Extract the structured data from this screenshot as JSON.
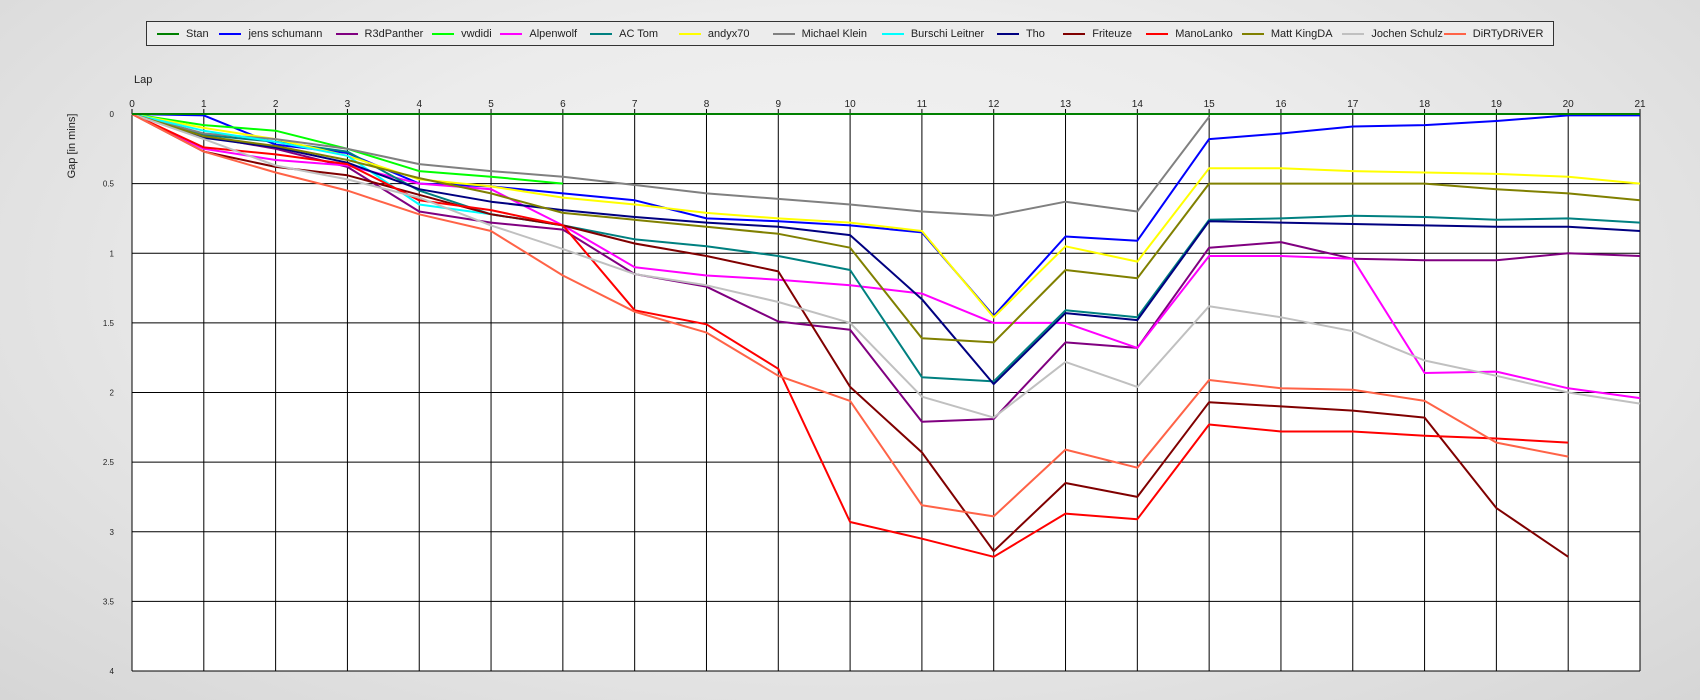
{
  "chart_data": {
    "type": "line",
    "xlabel": "Lap",
    "ylabel": "Gap [in mins]",
    "xlim": [
      0,
      21
    ],
    "ylim": [
      0,
      4
    ],
    "y_inverted": true,
    "x_ticks": [
      0,
      1,
      2,
      3,
      4,
      5,
      6,
      7,
      8,
      9,
      10,
      11,
      12,
      13,
      14,
      15,
      16,
      17,
      18,
      19,
      20,
      21
    ],
    "y_ticks": [
      "0",
      "0.5",
      "1",
      "1.5",
      "2",
      "2.5",
      "3",
      "3.5",
      "4"
    ],
    "grid": true,
    "legend_position": "top",
    "x": [
      0,
      1,
      2,
      3,
      4,
      5,
      6,
      7,
      8,
      9,
      10,
      11,
      12,
      13,
      14,
      15,
      16,
      17,
      18,
      19,
      20,
      21
    ],
    "series": [
      {
        "name": "Stan",
        "color": "#008000",
        "values": [
          0,
          0,
          0,
          0,
          0,
          0,
          0,
          0,
          0,
          0,
          0,
          0,
          0,
          0,
          0,
          0,
          0,
          0,
          0,
          0,
          0,
          0
        ]
      },
      {
        "name": "jens  schumann",
        "color": "#0000ff",
        "values": [
          0,
          0.01,
          0.22,
          0.28,
          0.5,
          0.52,
          0.57,
          0.62,
          0.75,
          0.77,
          0.8,
          0.85,
          1.45,
          0.88,
          0.91,
          0.18,
          0.14,
          0.09,
          0.08,
          0.05,
          0.01,
          0.01
        ]
      },
      {
        "name": "R3dPanther",
        "color": "#800080",
        "values": [
          0,
          0.16,
          0.25,
          0.38,
          0.7,
          0.78,
          0.83,
          1.15,
          1.24,
          1.49,
          1.55,
          2.21,
          2.19,
          1.64,
          1.68,
          0.96,
          0.92,
          1.04,
          1.05,
          1.05,
          1.0,
          1.02
        ]
      },
      {
        "name": "vwdidi",
        "color": "#00ff00",
        "values": [
          0,
          0.08,
          0.12,
          0.25,
          0.41,
          0.45,
          0.5,
          null,
          null,
          null,
          null,
          null,
          null,
          null,
          null,
          null,
          null,
          null,
          null,
          null,
          null,
          null
        ]
      },
      {
        "name": "Alpenwolf",
        "color": "#ff00ff",
        "values": [
          0,
          0.25,
          0.33,
          0.37,
          0.5,
          0.54,
          0.8,
          1.1,
          1.16,
          1.19,
          1.23,
          1.29,
          1.5,
          1.5,
          1.68,
          1.02,
          1.02,
          1.04,
          1.86,
          1.85,
          1.97,
          2.04
        ]
      },
      {
        "name": "AC Tom",
        "color": "#008080",
        "values": [
          0,
          0.15,
          0.2,
          0.27,
          0.55,
          0.72,
          0.8,
          0.9,
          0.95,
          1.02,
          1.12,
          1.89,
          1.92,
          1.41,
          1.46,
          0.76,
          0.75,
          0.73,
          0.74,
          0.76,
          0.75,
          0.78
        ]
      },
      {
        "name": "andyx70",
        "color": "#ffff00",
        "values": [
          0,
          0.1,
          0.18,
          0.3,
          0.47,
          0.52,
          0.6,
          0.65,
          0.71,
          0.75,
          0.78,
          0.84,
          1.46,
          0.95,
          1.06,
          0.39,
          0.39,
          0.41,
          0.42,
          0.43,
          0.45,
          0.5
        ]
      },
      {
        "name": "Michael Klein",
        "color": "#808080",
        "values": [
          0,
          0.14,
          0.18,
          0.25,
          0.36,
          0.41,
          0.45,
          0.51,
          0.57,
          0.61,
          0.65,
          0.7,
          0.73,
          0.63,
          0.7,
          0.02,
          null,
          null,
          null,
          null,
          null,
          0.03
        ]
      },
      {
        "name": "Burschi Leitner",
        "color": "#00ffff",
        "values": [
          0,
          0.12,
          0.2,
          0.3,
          0.65,
          0.72,
          0.8,
          null,
          null,
          null,
          null,
          null,
          null,
          null,
          null,
          null,
          null,
          null,
          null,
          null,
          null,
          null
        ]
      },
      {
        "name": "Tho",
        "color": "#000080",
        "values": [
          0,
          0.17,
          0.24,
          0.35,
          0.54,
          0.63,
          0.69,
          0.74,
          0.78,
          0.81,
          0.87,
          1.33,
          1.94,
          1.43,
          1.48,
          0.77,
          0.78,
          0.79,
          0.8,
          0.81,
          0.81,
          0.84
        ]
      },
      {
        "name": "Friteuze",
        "color": "#800000",
        "values": [
          0,
          0.27,
          0.38,
          0.44,
          0.58,
          0.72,
          0.8,
          0.93,
          1.02,
          1.13,
          1.96,
          2.43,
          3.14,
          2.65,
          2.75,
          2.07,
          2.1,
          2.13,
          2.18,
          2.83,
          3.18,
          null
        ]
      },
      {
        "name": "ManoLanko",
        "color": "#ff0000",
        "values": [
          0,
          0.24,
          0.29,
          0.36,
          0.62,
          0.69,
          0.8,
          1.41,
          1.51,
          1.83,
          2.93,
          3.05,
          3.18,
          2.87,
          2.91,
          2.23,
          2.28,
          2.28,
          2.31,
          2.33,
          2.36,
          null
        ]
      },
      {
        "name": "Matt KingDA",
        "color": "#808000",
        "values": [
          0,
          0.16,
          0.23,
          0.33,
          0.46,
          0.57,
          0.71,
          0.76,
          0.81,
          0.86,
          0.96,
          1.61,
          1.64,
          1.12,
          1.18,
          0.5,
          0.5,
          0.5,
          0.5,
          0.54,
          0.57,
          0.62
        ]
      },
      {
        "name": "Jochen Schulz",
        "color": "#c0c0c0",
        "values": [
          0,
          0.18,
          0.37,
          0.47,
          0.6,
          0.8,
          0.97,
          1.15,
          1.23,
          1.35,
          1.5,
          2.03,
          2.18,
          1.78,
          1.96,
          1.38,
          1.46,
          1.56,
          1.77,
          1.88,
          2.0,
          2.08
        ]
      },
      {
        "name": "DiRTyDRiVER",
        "color": "#ff6347",
        "values": [
          0,
          0.27,
          0.42,
          0.55,
          0.72,
          0.84,
          1.16,
          1.42,
          1.57,
          1.88,
          2.06,
          2.81,
          2.89,
          2.41,
          2.54,
          1.91,
          1.97,
          1.98,
          2.06,
          2.36,
          2.46,
          null
        ]
      }
    ]
  }
}
